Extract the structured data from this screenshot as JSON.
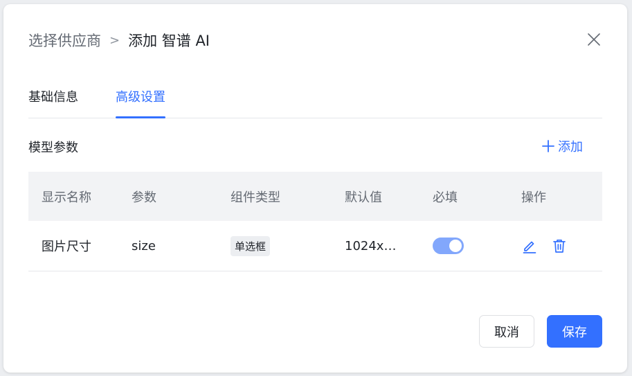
{
  "breadcrumb": {
    "parent": "选择供应商",
    "separator": ">",
    "current": "添加 智谱 AI"
  },
  "tabs": [
    {
      "label": "基础信息",
      "active": false
    },
    {
      "label": "高级设置",
      "active": true
    }
  ],
  "section": {
    "title": "模型参数",
    "add_label": "添加"
  },
  "table": {
    "headers": [
      "显示名称",
      "参数",
      "组件类型",
      "默认值",
      "必填",
      "操作"
    ],
    "rows": [
      {
        "display_name": "图片尺寸",
        "param": "size",
        "component_type": "单选框",
        "default_value": "1024x…",
        "required": true
      }
    ]
  },
  "footer": {
    "cancel_label": "取消",
    "save_label": "保存"
  },
  "colors": {
    "accent": "#3370ff",
    "switch_on": "#82a7fc",
    "header_bg": "#f2f3f5"
  },
  "icons": {
    "close": "close-icon",
    "add": "plus-icon",
    "edit": "edit-icon",
    "delete": "trash-icon"
  }
}
